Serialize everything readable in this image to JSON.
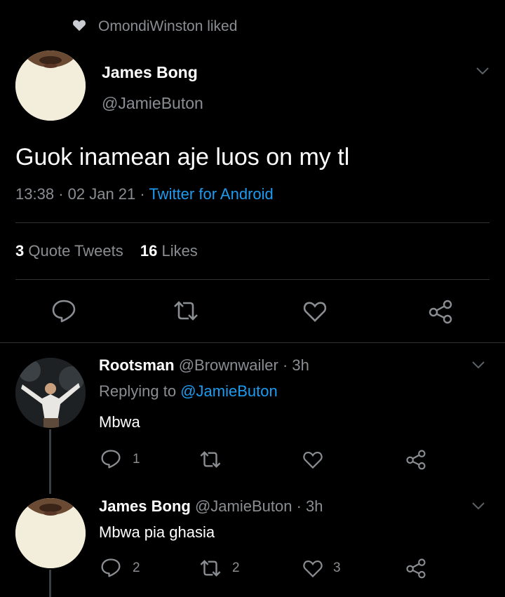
{
  "social_context": {
    "text": "OmondiWinston liked"
  },
  "main_tweet": {
    "display_name": "James Bong",
    "handle": "@JamieButon",
    "text": "Guok inamean aje luos on my tl",
    "time": "13:38",
    "date": "02 Jan 21",
    "source": "Twitter for Android",
    "quote_count": "3",
    "quote_label": "Quote Tweets",
    "likes_count": "16",
    "likes_label": "Likes"
  },
  "replies": [
    {
      "display_name": "Rootsman",
      "handle": "@Brownwailer",
      "age": "3h",
      "replying_prefix": "Replying to",
      "replying_to": "@JamieButon",
      "text": "Mbwa",
      "reply_count": "1",
      "retweet_count": "",
      "like_count": ""
    },
    {
      "display_name": "James Bong",
      "handle": "@JamieButon",
      "age": "3h",
      "text": "Mbwa pia ghasia",
      "reply_count": "2",
      "retweet_count": "2",
      "like_count": "3"
    }
  ],
  "separator": "·",
  "colors": {
    "background": "#000000",
    "text": "#ffffff",
    "muted": "#8a8d91",
    "link": "#1d9bf0",
    "divider": "#2f3336"
  }
}
